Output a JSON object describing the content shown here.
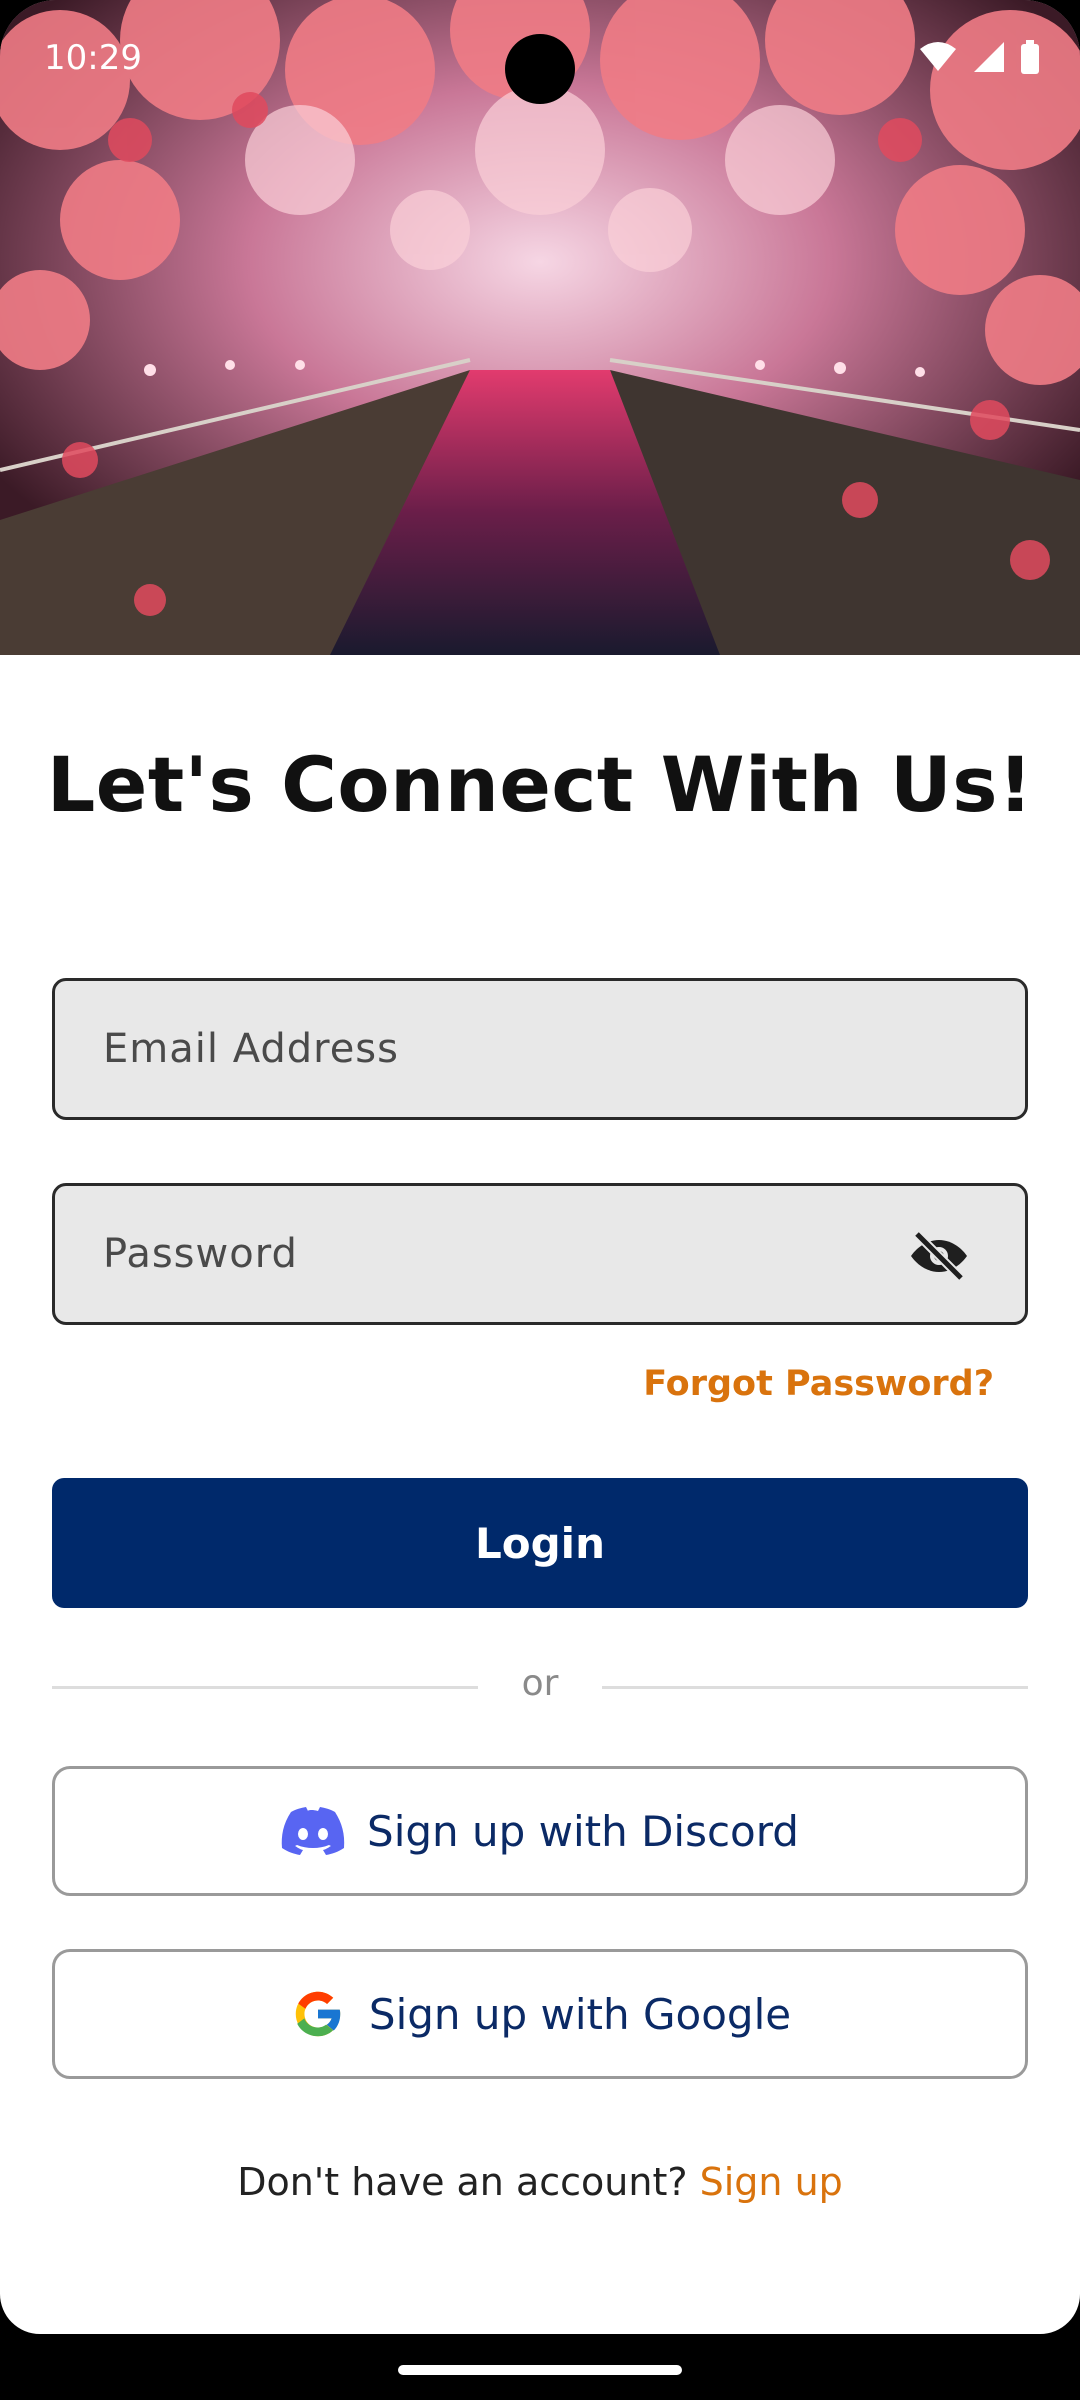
{
  "status_bar": {
    "time": "10:29"
  },
  "hero": {
    "image_subject": "cherry-blossom-canal-night"
  },
  "heading": "Let's Connect With Us!",
  "form": {
    "email_placeholder": "Email Address",
    "password_placeholder": "Password",
    "forgot_password": "Forgot Password?",
    "login_label": "Login",
    "divider_text": "or"
  },
  "social": {
    "discord_label": "Sign up with Discord",
    "google_label": "Sign up with Google"
  },
  "footer": {
    "prompt": "Don't have an account?",
    "signup_link": "Sign up"
  },
  "colors": {
    "primary": "#00296b",
    "accent": "#d9730d",
    "field_bg": "#e8e8e8",
    "discord": "#5865f2"
  }
}
